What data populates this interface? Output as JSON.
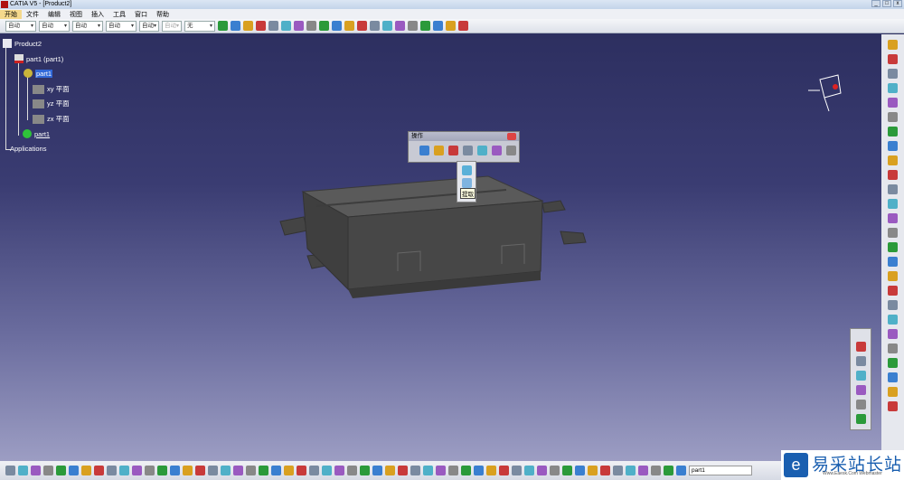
{
  "window": {
    "title": "CATIA V5 - [Product2]"
  },
  "menu": [
    "开始",
    "文件",
    "编辑",
    "视图",
    "插入",
    "工具",
    "窗口",
    "帮助"
  ],
  "toolbar": {
    "dropdowns": [
      "自动",
      "自动",
      "自动",
      "自动",
      "自动",
      "自动",
      "无"
    ]
  },
  "tree": {
    "root": "Product2",
    "child": "part1 (part1)",
    "part": "part1",
    "planes": [
      "xy 平面",
      "yz 平面",
      "zx 平面"
    ],
    "body": "part1",
    "applications": "Applications"
  },
  "operation_toolbar": {
    "title": "操作",
    "tooltip": "提取"
  },
  "command_input": {
    "value": "part1"
  },
  "watermark": {
    "name": "易采站长站",
    "sub": "Www.Eaesk.Com Webmaster"
  },
  "colors": {
    "viewport_top": "#2d2f60",
    "viewport_bottom": "#9c9dc3",
    "model": "#4b4b4b",
    "selection": "#3168d8"
  }
}
